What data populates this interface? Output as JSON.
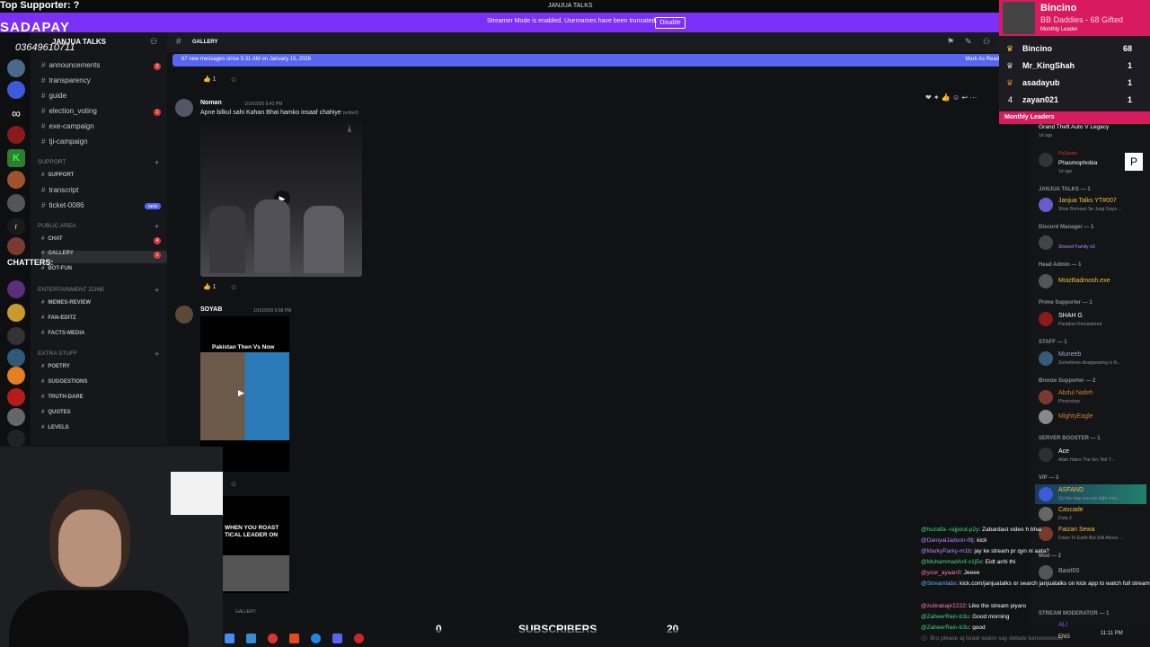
{
  "overlay": {
    "top_supporter": "Top Supporter: ?",
    "sadapay": "SADAPAY",
    "account_number": "03649610711",
    "chatters": "CHATTERS:",
    "subscribers_left": "0",
    "subscribers_label": "SUBSCRIBERS",
    "subscribers_right": "20"
  },
  "window": {
    "title": "JANJUA TALKS"
  },
  "banner": {
    "text": "Streamer Mode is enabled. Usernames have been truncated.",
    "disable_label": "Disable"
  },
  "server": {
    "name": "JANJUA TALKS"
  },
  "channels": {
    "ann": "announcements",
    "transparency": "transparency",
    "guide": "guide",
    "election": "election_voting",
    "exe": "exe-campaign",
    "tji": "tji-campaign",
    "cat_support": "SUPPORT",
    "support": "SUPPORT",
    "transcript": "transcript",
    "ticket": "ticket-0086",
    "new": "NEW",
    "cat_public": "PUBLIC AREA",
    "chat": "CHAT",
    "gallery": "GALLERY",
    "botfun": "BOT-FUN",
    "cat_ent": "ENTERTAINMENT ZONE",
    "memes": "MEMES-REVIEW",
    "fanedit": "FAN-EDITZ",
    "facts": "FACTS-MEDIA",
    "cat_extra": "EXTRA STUFF",
    "poetry": "POETRY",
    "sugg": "SUGGESTIONS",
    "truth": "TRUTH-DARE",
    "quotes": "QUOTES",
    "levels": "LEVELS",
    "badges": {
      "ann": "2",
      "election": "1",
      "chat": "4",
      "gallery": "1"
    }
  },
  "chat": {
    "channel_title": "GALLERY",
    "new_messages": "67 new messages since 5:31 AM on January 15, 2026",
    "mark_read": "Mark As Read",
    "reaction_count": "1",
    "msg1": {
      "author": "Noman",
      "time": "1/16/2026 8:43 PM",
      "text": "Apne bilkul sahi Kahan Bhai hamko insaaf chahiye",
      "edited": "(edited)"
    },
    "msg2": {
      "author": "SOYAB",
      "time": "1/16/2026 9:08 PM",
      "card_title": "Pakistan Then Vs Now",
      "meme_text": "WHEN YOU ROAST\nTICAL LEADER ON"
    },
    "footer_channel": "GALLERY"
  },
  "leaderboard": {
    "title": "Bincino",
    "subtitle": "BB Daddies - 68 Gifted",
    "tag": "Monthly Leader",
    "rows": [
      {
        "rank": "",
        "name": "Bincino",
        "val": "68"
      },
      {
        "rank": "",
        "name": "Mr_KingShah",
        "val": "1"
      },
      {
        "rank": "",
        "name": "asadayub",
        "val": "1"
      },
      {
        "rank": "4",
        "name": "zayan021",
        "val": "1"
      }
    ],
    "footer": "Monthly Leaders"
  },
  "members": {
    "top_game": "Grand Theft Auto V Legacy",
    "top_game_time": "1d ago",
    "phasmo_user": "PuZavian",
    "phasmo_game": "Phasmophobia",
    "phasmo_time": "1d ago",
    "h_janjua": "JANJUA TALKS — 1",
    "janjua_name": "Janjua Talks YT#007",
    "janjua_status": "Shair Bemaari Se Jaag Gaya ...",
    "h_discord": "Discord Manager — 1",
    "discord_status": "Shareef Family xD",
    "h_head": "Head Admin — 1",
    "head_name": "MoizBadmosh.exe",
    "h_prime": "Prime Supporter — 1",
    "prime_name": "SHAH G",
    "prime_status": "Paradise Remastered",
    "h_staff": "STAFF — 1",
    "staff_name": "Muneeb",
    "staff_status": "Sometimes disappearing is th...",
    "h_bronze": "Bronze Supporter — 2",
    "bronze1": "Abdul Nafeh",
    "bronze1_status": "Photoshop",
    "bronze2": "MightyEagle",
    "h_booster": "SERVER BOOSTER — 1",
    "booster_name": "Ace",
    "booster_status": "Allah Hates The Sin, Not T...",
    "h_vip": "VIP — 3",
    "vip1": "ASFAND",
    "vip1_status": "Go the way you are right now.",
    "vip2": "Cascade",
    "vip2_status": "Dota 2",
    "vip3": "Faizan Sewa",
    "vip3_status": "Down To Earth But Still Above ...",
    "h_mod": "Mod — 2",
    "mod1": "Basit00",
    "h_streammod": "STREAM MODERATOR — 1",
    "streammod": "ALI"
  },
  "twitch_chat": [
    {
      "user": "@huzaifa--rajpoot-p2y",
      "msg": ": Zabardast video h bhai",
      "color": "#3ddc84"
    },
    {
      "user": "@DaniyalJadoon-f8j",
      "msg": ": kick",
      "color": "#b388ff"
    },
    {
      "user": "@MarkyParky-m1b",
      "msg": ": jay ke stream pr qyn ni aata?",
      "color": "#b388ff"
    },
    {
      "user": "@MuhammadArif-v1j5x",
      "msg": ": Eidt achi thi",
      "color": "#3ddc84"
    },
    {
      "user": "@your_ayaan0",
      "msg": ": Jeeee",
      "color": "#ff7ab6"
    },
    {
      "user": "@Streamlabs",
      "msg": ": kick.com/janjuatalks or search janjuatalks on kick app to watch full stream",
      "color": "#6ab0ff"
    },
    {
      "user": "@zubrabajir2222",
      "msg": ": Like the stream piyaro",
      "color": "#ff7ab6"
    },
    {
      "user": "@ZaheerRain-b3u",
      "msg": ": Good morning",
      "color": "#3ddc84"
    },
    {
      "user": "@ZaheerRain-b3u",
      "msg": ": good",
      "color": "#3ddc84"
    },
    {
      "user": "@",
      "msg": ": Bro please aj israel walon say debate karoooooooo",
      "color": "#6ab0ff"
    }
  ],
  "taskbar": {
    "clock": "11:11 PM",
    "lang": "ENG"
  },
  "colors": {
    "accent": "#5865f2",
    "banner": "#7b2ff7",
    "leader": "#d81b60"
  }
}
